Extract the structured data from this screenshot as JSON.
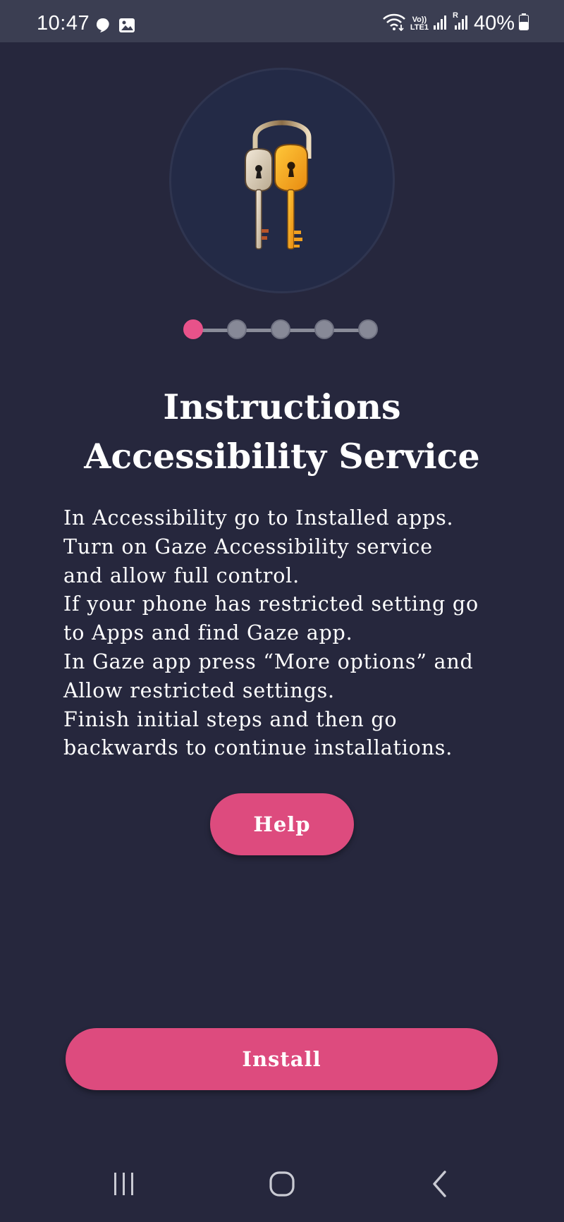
{
  "status_bar": {
    "time": "10:47",
    "left_icons": [
      "chat-bubble-icon",
      "image-icon"
    ],
    "network_label_top": "Vo))",
    "network_label_bottom": "LTE1",
    "sim2_label": "R",
    "battery_percent": "40%"
  },
  "onboarding": {
    "hero_icon": "padlock-keys-icon",
    "steps_total": 5,
    "step_current": 1,
    "title_line1": "Instructions",
    "title_line2": "Accessibility Service",
    "instructions": [
      "In Accessibility go to Installed apps.",
      "Turn on Gaze Accessibility service",
      "and allow full control.",
      "If your phone has restricted setting go",
      "to Apps and find Gaze app.",
      "In Gaze app press “More options” and",
      "Allow restricted settings.",
      "Finish initial steps and then go",
      "backwards to continue installations."
    ],
    "help_label": "Help",
    "install_label": "Install"
  },
  "colors": {
    "background": "#26273d",
    "accent": "#dd4b7e",
    "active_step": "#e8528a",
    "inactive_step": "#878997"
  },
  "nav_bar": {
    "recents_icon": "recents-icon",
    "home_icon": "home-icon",
    "back_icon": "back-icon"
  }
}
